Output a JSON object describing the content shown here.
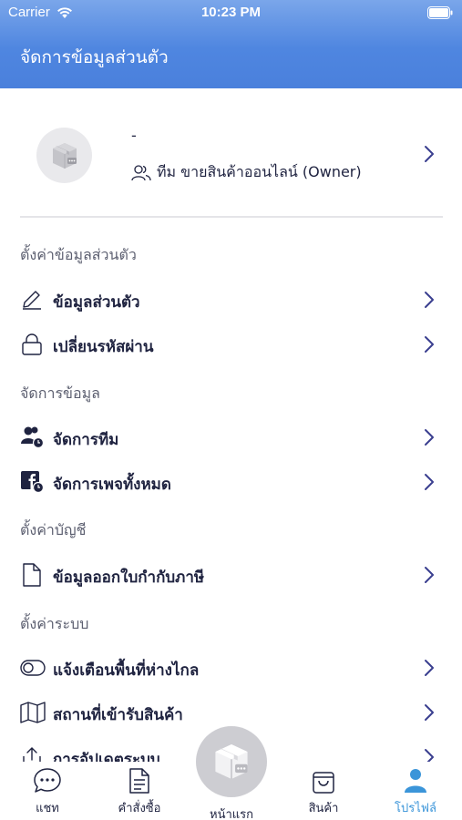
{
  "status_bar": {
    "carrier": "Carrier",
    "time": "10:23 PM"
  },
  "header": {
    "title": "จัดการข้อมูลส่วนตัว"
  },
  "profile": {
    "name": "-",
    "team": "ทีม ขายสินค้าออนไลน์ (Owner)"
  },
  "sections": {
    "personal": {
      "title": "ตั้งค่าข้อมูลส่วนตัว",
      "items": [
        {
          "label": "ข้อมูลส่วนตัว",
          "icon": "pencil-icon"
        },
        {
          "label": "เปลี่ยนรหัสผ่าน",
          "icon": "lock-icon"
        }
      ]
    },
    "data": {
      "title": "จัดการข้อมูล",
      "items": [
        {
          "label": "จัดการทีม",
          "icon": "team-icon"
        },
        {
          "label": "จัดการเพจทั้งหมด",
          "icon": "facebook-icon"
        }
      ]
    },
    "account": {
      "title": "ตั้งค่าบัญชี",
      "items": [
        {
          "label": "ข้อมูลออกใบกำกับภาษี",
          "icon": "document-icon"
        }
      ]
    },
    "system": {
      "title": "ตั้งค่าระบบ",
      "items": [
        {
          "label": "แจ้งเตือนพื้นที่ห่างไกล",
          "icon": "toggle-icon"
        },
        {
          "label": "สถานที่เข้ารับสินค้า",
          "icon": "map-icon"
        },
        {
          "label": "การอัปเดตระบบ",
          "icon": "upload-icon"
        }
      ]
    }
  },
  "tabbar": {
    "chat": "แชท",
    "orders": "คำสั่งซื้อ",
    "home": "หน้าแรก",
    "products": "สินค้า",
    "profile": "โปรไฟล์",
    "active_color": "#3b95d9"
  },
  "colors": {
    "header": "#4f86e0",
    "chevron": "#3a3f8f",
    "text": "#1f2340"
  }
}
